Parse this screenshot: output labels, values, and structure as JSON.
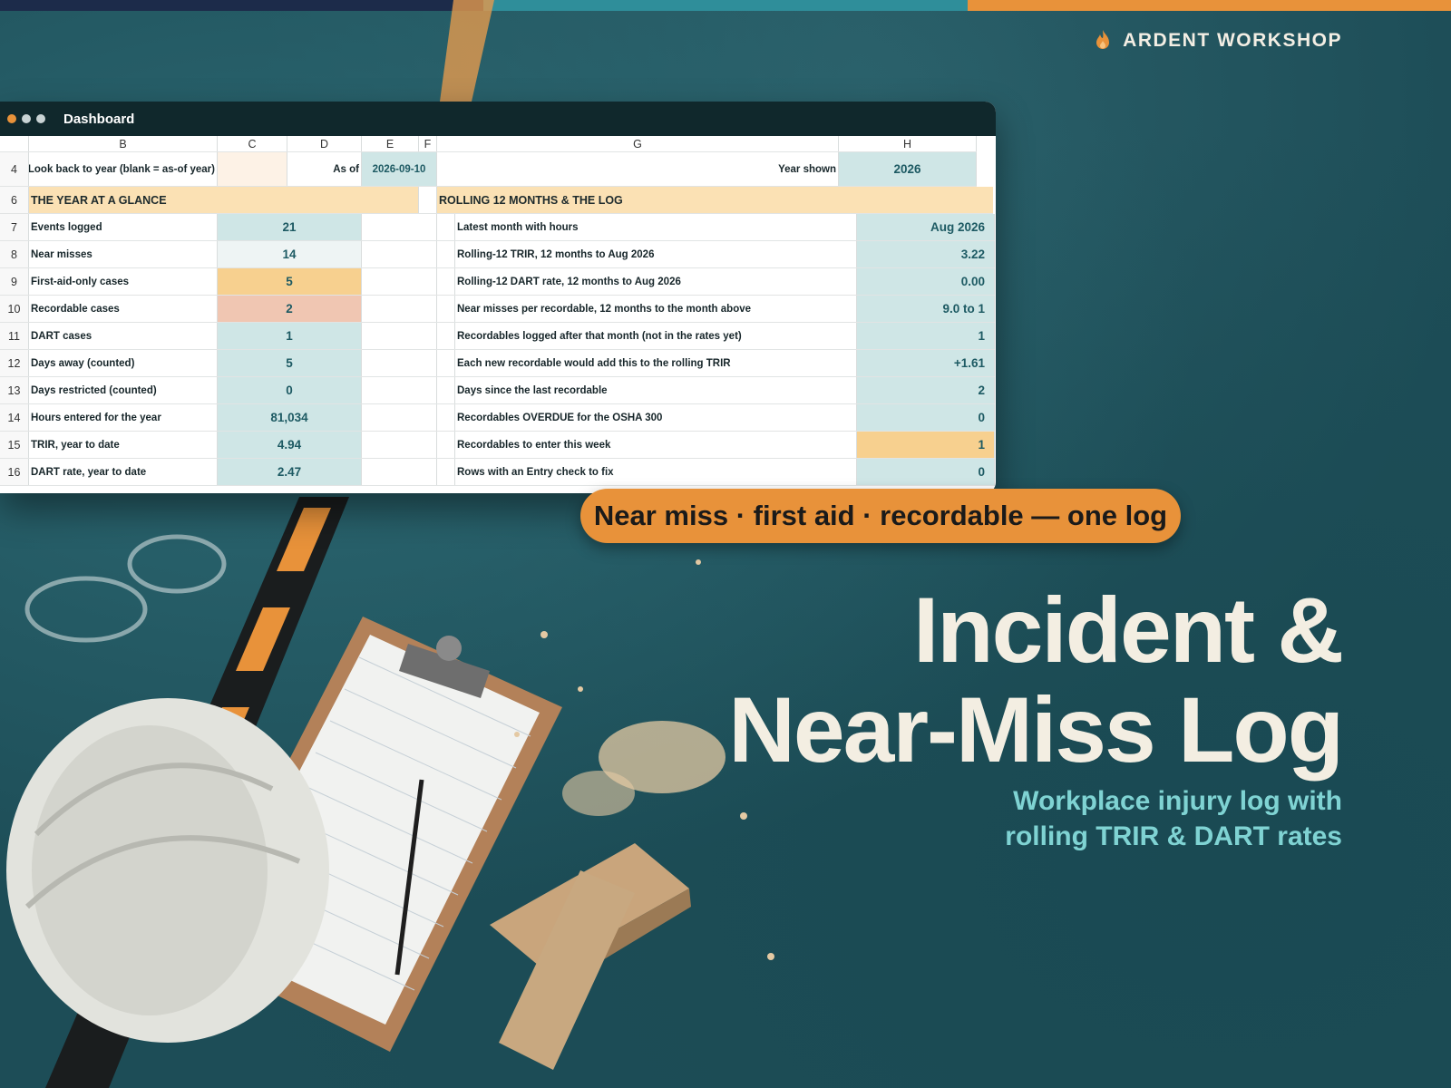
{
  "colors": {
    "stripe": [
      "#1c2b4a",
      "#2f8e9a",
      "#e8923a"
    ],
    "accent_orange": "#e8923a",
    "cell_teal": "#cfe6e6",
    "cell_light": "#eef4f4",
    "cell_yellow": "#f7d08f",
    "cell_salmon": "#f0c6b2",
    "section_band": "#fbe1b4",
    "input_cell": "#fdf2e6"
  },
  "brand": {
    "name": "ARDENT WORKSHOP",
    "icon": "flame-icon"
  },
  "window": {
    "title": "Dashboard",
    "traffic_dots": [
      "#e8923a",
      "#c9d3d4",
      "#c9d3d4"
    ]
  },
  "sheet": {
    "columns": [
      "B",
      "C",
      "D",
      "E",
      "F",
      "G",
      "H"
    ],
    "row4": {
      "num": "4",
      "label": "Look back to year (blank = as-of year)",
      "as_of_label": "As of",
      "as_of_value": "2026-09-10",
      "year_label": "Year shown",
      "year_value": "2026"
    },
    "row6": {
      "num": "6",
      "left_section": "THE YEAR AT A GLANCE",
      "right_section": "ROLLING 12 MONTHS & THE LOG"
    },
    "rows": [
      {
        "num": "7",
        "left_label": "Events logged",
        "left_value": "21",
        "right_label": "Latest month with hours",
        "right_value": "Aug 2026"
      },
      {
        "num": "8",
        "left_label": "Near misses",
        "left_value": "14",
        "right_label": "Rolling-12 TRIR, 12 months to Aug 2026",
        "right_value": "3.22"
      },
      {
        "num": "9",
        "left_label": "First-aid-only cases",
        "left_value": "5",
        "right_label": "Rolling-12 DART rate, 12 months to Aug 2026",
        "right_value": "0.00"
      },
      {
        "num": "10",
        "left_label": "Recordable cases",
        "left_value": "2",
        "right_label": "Near misses per recordable, 12 months to the month above",
        "right_value": "9.0 to 1"
      },
      {
        "num": "11",
        "left_label": "DART cases",
        "left_value": "1",
        "right_label": "Recordables logged after that month (not in the rates yet)",
        "right_value": "1"
      },
      {
        "num": "12",
        "left_label": "Days away (counted)",
        "left_value": "5",
        "right_label": "Each new recordable would add this to the rolling TRIR",
        "right_value": "+1.61"
      },
      {
        "num": "13",
        "left_label": "Days restricted (counted)",
        "left_value": "0",
        "right_label": "Days since the last recordable",
        "right_value": "2"
      },
      {
        "num": "14",
        "left_label": "Hours entered for the year",
        "left_value": "81,034",
        "right_label": "Recordables OVERDUE for the OSHA 300",
        "right_value": "0"
      },
      {
        "num": "15",
        "left_label": "TRIR, year to date",
        "left_value": "4.94",
        "right_label": "Recordables to enter this week",
        "right_value": "1"
      },
      {
        "num": "16",
        "left_label": "DART rate, year to date",
        "left_value": "2.47",
        "right_label": "Rows with an Entry check to fix",
        "right_value": "0"
      }
    ]
  },
  "pill": {
    "text": "Near miss · first aid · recordable — one log"
  },
  "hero": {
    "line1": "Incident &",
    "line2": "Near-Miss Log"
  },
  "subtitle": {
    "line1": "Workplace injury log with",
    "line2": "rolling TRIR & DART rates"
  }
}
